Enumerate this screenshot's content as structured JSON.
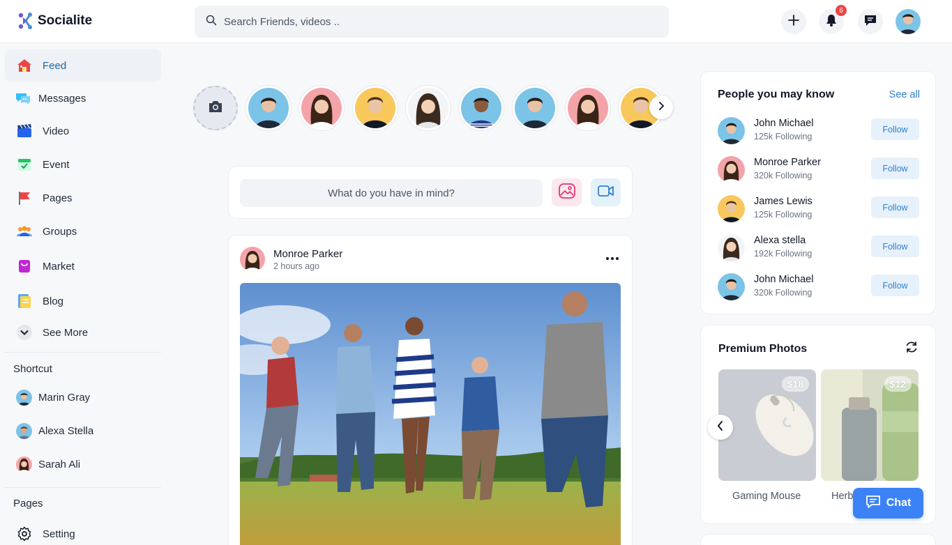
{
  "app": {
    "name": "Socialite"
  },
  "header": {
    "search_placeholder": "Search Friends, videos ..",
    "notification_count": "6"
  },
  "sidebar": {
    "items": [
      {
        "label": "Feed",
        "icon": "home-icon"
      },
      {
        "label": "Messages",
        "icon": "messages-icon"
      },
      {
        "label": "Video",
        "icon": "video-icon"
      },
      {
        "label": "Event",
        "icon": "calendar-icon"
      },
      {
        "label": "Pages",
        "icon": "flag-icon"
      },
      {
        "label": "Groups",
        "icon": "groups-icon"
      },
      {
        "label": "Market",
        "icon": "shopping-bag-icon"
      },
      {
        "label": "Blog",
        "icon": "blog-icon"
      },
      {
        "label": "See More",
        "icon": "chevron-down-icon"
      }
    ],
    "shortcut_title": "Shortcut",
    "shortcuts": [
      "Marin Gray",
      "Alexa Stella",
      "Sarah Ali"
    ],
    "pages_title": "Pages",
    "pages": [
      {
        "label": "Setting",
        "icon": "gear-icon"
      }
    ]
  },
  "composer": {
    "placeholder": "What do you have in mind?"
  },
  "post": {
    "author": "Monroe Parker",
    "time": "2 hours ago"
  },
  "people": {
    "title": "People you may know",
    "see_all": "See all",
    "follow_label": "Follow",
    "list": [
      {
        "name": "John Michael",
        "sub": "125k Following"
      },
      {
        "name": "Monroe Parker",
        "sub": "320k Following"
      },
      {
        "name": "James Lewis",
        "sub": "125k Following"
      },
      {
        "name": "Alexa stella",
        "sub": "192k Following"
      },
      {
        "name": "John Michael",
        "sub": "320k Following"
      }
    ]
  },
  "premium": {
    "title": "Premium Photos",
    "products": [
      {
        "name": "Gaming Mouse",
        "price": "$18"
      },
      {
        "name": "Herbal",
        "price": "$12"
      }
    ]
  },
  "chat": {
    "label": "Chat"
  },
  "colors": {
    "accent": "#3b82f6",
    "link": "#2f7fd0",
    "active_nav": "#1d64a5",
    "badge": "#ef4444"
  }
}
